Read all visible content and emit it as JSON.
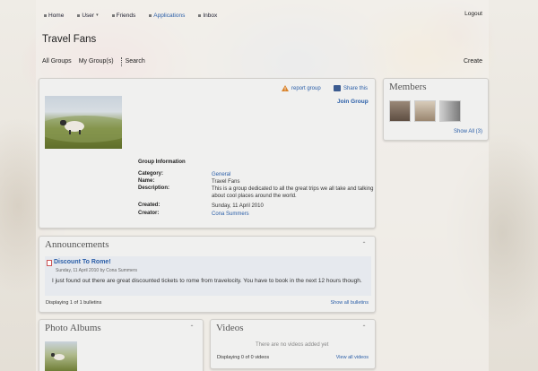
{
  "topnav": {
    "items": [
      {
        "label": "Home"
      },
      {
        "label": "User",
        "has_caret": true
      },
      {
        "label": "Friends"
      },
      {
        "label": "Applications"
      },
      {
        "label": "Inbox"
      }
    ],
    "logout": "Logout"
  },
  "page_title": "Travel Fans",
  "subnav": {
    "all_groups": "All Groups",
    "my_groups": "My Group(s)",
    "search": "Search",
    "create": "Create"
  },
  "group": {
    "report": "report group",
    "share": "Share this",
    "join": "Join Group",
    "info_title": "Group Information",
    "info": [
      {
        "label": "Category:",
        "value": "General",
        "link": true
      },
      {
        "label": "Name:",
        "value": "Travel Fans",
        "link": false
      },
      {
        "label": "Description:",
        "value": "This is a group dedicated to all the great trips we all take and talking about cool places around the world.",
        "link": false
      },
      {
        "label": "Created:",
        "value": "Sunday, 11 April 2010",
        "link": false
      },
      {
        "label": "Creator:",
        "value": "Cona Summers",
        "link": true
      }
    ]
  },
  "members": {
    "title": "Members",
    "show_all": "Show All (3)",
    "avatar_colors": [
      "#7a6a5c",
      "#b9a68e",
      "#9a9a9a"
    ]
  },
  "announcements": {
    "title": "Announcements",
    "item_title": "Discount To Rome!",
    "item_meta": "Sunday, 11 April 2010 by Cona Summers",
    "item_body": "I just found out there are great discounted tickets to rome from travelocity. You have to book in the next 12 hours though.",
    "footer_left": "Displaying 1 of 1 bulletins",
    "footer_right": "Show all bulletins"
  },
  "photo_albums": {
    "title": "Photo Albums"
  },
  "videos": {
    "title": "Videos",
    "empty": "There are no videos added yet",
    "footer_left": "Displaying 0 of 0 videos",
    "footer_right": "View all videos"
  },
  "colors": {
    "link": "#2a5ea8",
    "panel_bg": "#f0f0ef"
  }
}
